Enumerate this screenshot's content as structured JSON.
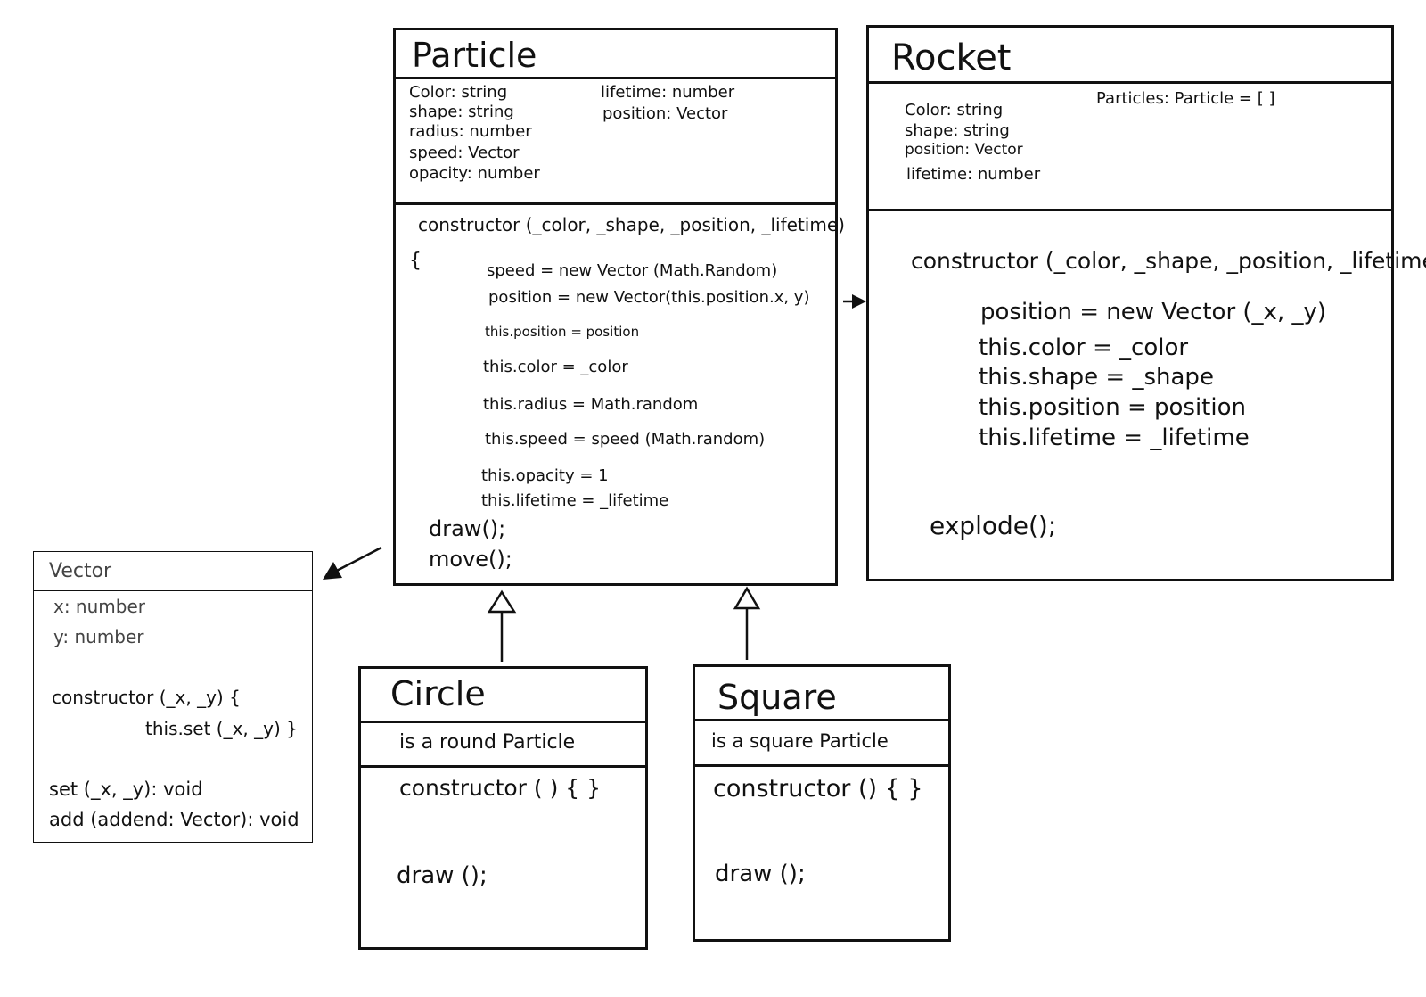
{
  "particle": {
    "name": "Particle",
    "attrs_left": [
      "Color: string",
      "shape: string",
      "radius: number",
      "speed: Vector",
      "opacity: number"
    ],
    "attrs_right": [
      "lifetime: number",
      "position: Vector"
    ],
    "constructor_sig": "constructor (_color, _shape, _position, _lifetime)",
    "brace_open": "{",
    "body": [
      "speed = new Vector (Math.Random)",
      "position = new Vector(this.position.x, y)",
      "this.position = position",
      "this.color = _color",
      "this.radius = Math.random",
      "this.speed = speed (Math.random)",
      "this.opacity = 1",
      "this.lifetime = _lifetime"
    ],
    "methods": [
      "draw();",
      "move();"
    ]
  },
  "rocket": {
    "name": "Rocket",
    "attrs_left": [
      "Color: string",
      "shape: string",
      "position: Vector",
      "lifetime: number"
    ],
    "attrs_right": [
      "Particles: Particle = [ ]"
    ],
    "constructor_sig": "constructor (_color, _shape, _position, _lifetime) {",
    "body": [
      "position = new Vector (_x, _y)",
      "this.color = _color",
      "this.shape = _shape",
      "this.position = position",
      "this.lifetime = _lifetime"
    ],
    "methods": [
      "explode();"
    ]
  },
  "vector": {
    "name": "Vector",
    "attrs": [
      "x: number",
      "y: number"
    ],
    "constructor_line1": "constructor (_x, _y) {",
    "constructor_line2": "this.set (_x, _y) }",
    "methods": [
      "set (_x, _y): void",
      "add (addend: Vector): void"
    ]
  },
  "circle": {
    "name": "Circle",
    "desc": "is a round Particle",
    "constructor": "constructor ( ) { }",
    "method": "draw ();"
  },
  "square": {
    "name": "Square",
    "desc": "is a square Particle",
    "constructor": "constructor () { }",
    "method": "draw ();"
  }
}
